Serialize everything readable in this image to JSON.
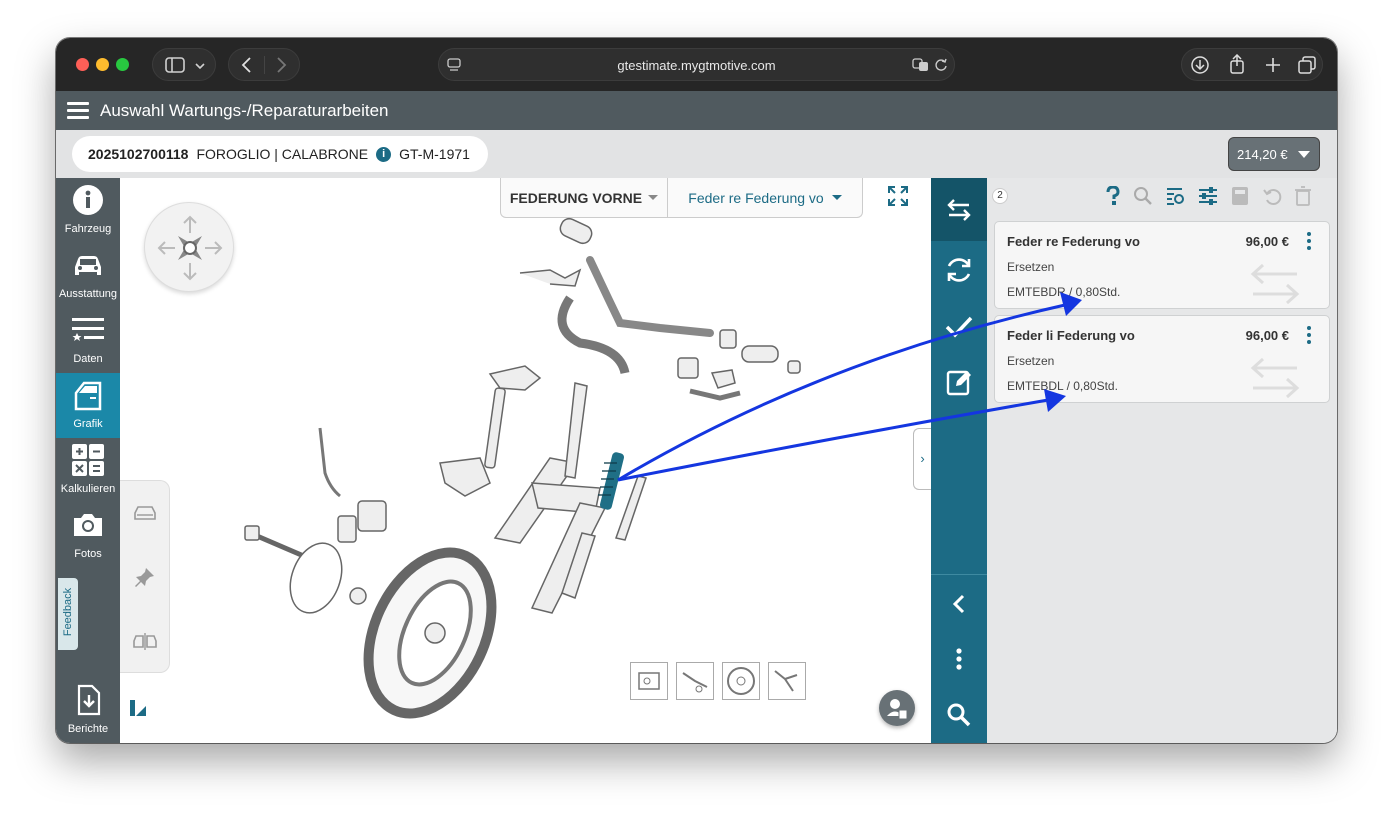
{
  "browser": {
    "url": "gtestimate.mygtmotive.com"
  },
  "app": {
    "title": "Auswahl Wartungs-/Reparaturarbeiten"
  },
  "vehicle": {
    "id": "2025102700118",
    "name": "FOROGLIO | CALABRONE",
    "plate": "GT-M-1971",
    "info_glyph": "i"
  },
  "total": {
    "price": "214,20 €"
  },
  "nav": {
    "items": [
      {
        "label": "Fahrzeug",
        "icon": "info-icon"
      },
      {
        "label": "Ausstattung",
        "icon": "car-icon"
      },
      {
        "label": "Daten",
        "icon": "list-star-icon"
      },
      {
        "label": "Grafik",
        "icon": "car-door-icon",
        "active": true
      },
      {
        "label": "Kalkulieren",
        "icon": "calculator-icon"
      },
      {
        "label": "Fotos",
        "icon": "camera-icon"
      },
      {
        "label": "Berichte",
        "icon": "download-doc-icon"
      }
    ],
    "feedback": "Feedback"
  },
  "graphic": {
    "group": "FEDERUNG VORNE",
    "part": "Feder re Federung vo",
    "toggle_glyph": "›"
  },
  "operations": {
    "count": "2",
    "items": [
      {
        "name": "Feder re Federung vo",
        "price": "96,00 €",
        "action": "Ersetzen",
        "code": "EMTEBDR / 0,80Std."
      },
      {
        "name": "Feder li Federung vo",
        "price": "96,00 €",
        "action": "Ersetzen",
        "code": "EMTEBDL / 0,80Std."
      }
    ]
  },
  "colors": {
    "teal": "#1c6b85",
    "active_nav": "#1b88a8",
    "header": "#505a5f",
    "annotation_arrow": "#1436e0"
  }
}
